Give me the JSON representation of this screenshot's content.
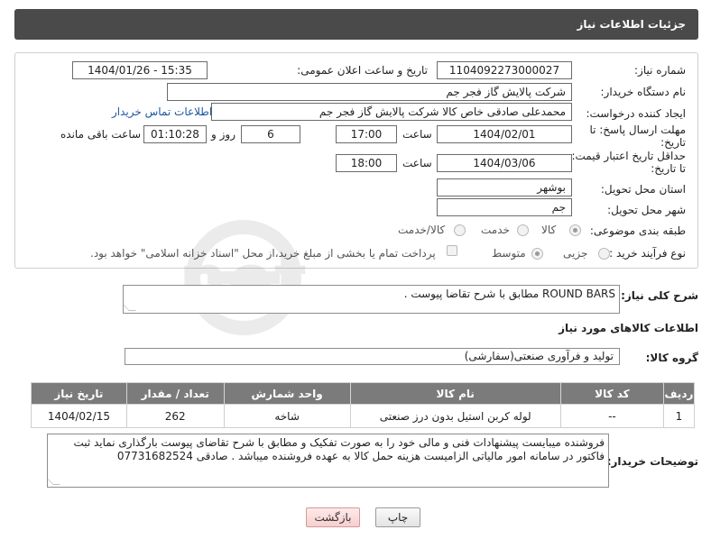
{
  "header": {
    "title": "جزئیات اطلاعات نیاز"
  },
  "form": {
    "need_number": {
      "label": "شماره نیاز:",
      "value": "1104092273000027"
    },
    "announce_datetime": {
      "label": "تاریخ و ساعت اعلان عمومی:",
      "value": "1404/01/26 - 15:35"
    },
    "buyer_org": {
      "label": "نام دستگاه خریدار:",
      "value": "شرکت پالایش گاز فجر جم"
    },
    "creator": {
      "label": "ایجاد کننده درخواست:",
      "value": "محمدعلی صادقی خاص کالا شرکت پالایش گاز فجر جم",
      "contact_link": "اطلاعات تماس خریدار"
    },
    "response_deadline": {
      "label_line1": "مهلت ارسال پاسخ: تا",
      "label_line2": "تاریخ:",
      "date": "1404/02/01",
      "time_label": "ساعت",
      "time": "17:00",
      "days": "6",
      "days_label": "روز و",
      "remaining": "01:10:28",
      "remaining_label": "ساعت باقی مانده"
    },
    "price_validity": {
      "label_line1": "حداقل تاریخ اعتبار قیمت:",
      "label_line2": "تا تاریخ:",
      "date": "1404/03/06",
      "time_label": "ساعت",
      "time": "18:00"
    },
    "delivery_province": {
      "label": "استان محل تحویل:",
      "value": "بوشهر"
    },
    "delivery_city": {
      "label": "شهر محل تحویل:",
      "value": "جم"
    },
    "category": {
      "label": "طبقه بندی موضوعی:",
      "options": [
        "کالا",
        "خدمت",
        "کالا/خدمت"
      ],
      "selected": "کالا"
    },
    "purchase_type": {
      "label": "نوع فرآیند خرید :",
      "options": [
        "جزیی",
        "متوسط"
      ],
      "selected": "متوسط",
      "checkbox_text": "پرداخت تمام یا بخشی از مبلغ خرید،از محل \"اسناد خزانه اسلامی\" خواهد بود."
    }
  },
  "description": {
    "label": "شرح کلی نیاز:",
    "value": "ROUND BARS مطابق با شرح تقاضا پیوست ."
  },
  "goods_section": {
    "title": "اطلاعات کالاهای مورد نیاز",
    "group_label": "گروه کالا:",
    "group_value": "تولید و فرآوری صنعتی(سفارشی)"
  },
  "table": {
    "headers": [
      "ردیف",
      "کد کالا",
      "نام کالا",
      "واحد شمارش",
      "تعداد / مقدار",
      "تاریخ نیاز"
    ],
    "rows": [
      [
        "1",
        "--",
        "لوله کربن استیل بدون درز صنعتی",
        "شاخه",
        "262",
        "1404/02/15"
      ]
    ]
  },
  "buyer_notes": {
    "label": "توضیحات خریدار:",
    "value": "فروشنده میبایست پیشنهادات فنی و مالی خود را به صورت تفکیک و مطابق با شرح تقاضای پیوست بارگذاری نماید ثبت فاکتور در سامانه امور مالیاتی الزامیست هزینه حمل کالا به عهده فروشنده میباشد . صادقی 07731682524"
  },
  "buttons": {
    "print": "چاپ",
    "back": "بازگشت"
  },
  "watermark": {
    "text": "AriaTender.net"
  },
  "colors": {
    "header_bg": "#4a4a4a",
    "table_header_bg": "#7b7b7b",
    "link": "#1e56a0",
    "back_button_bg": "#f7cfcf"
  }
}
